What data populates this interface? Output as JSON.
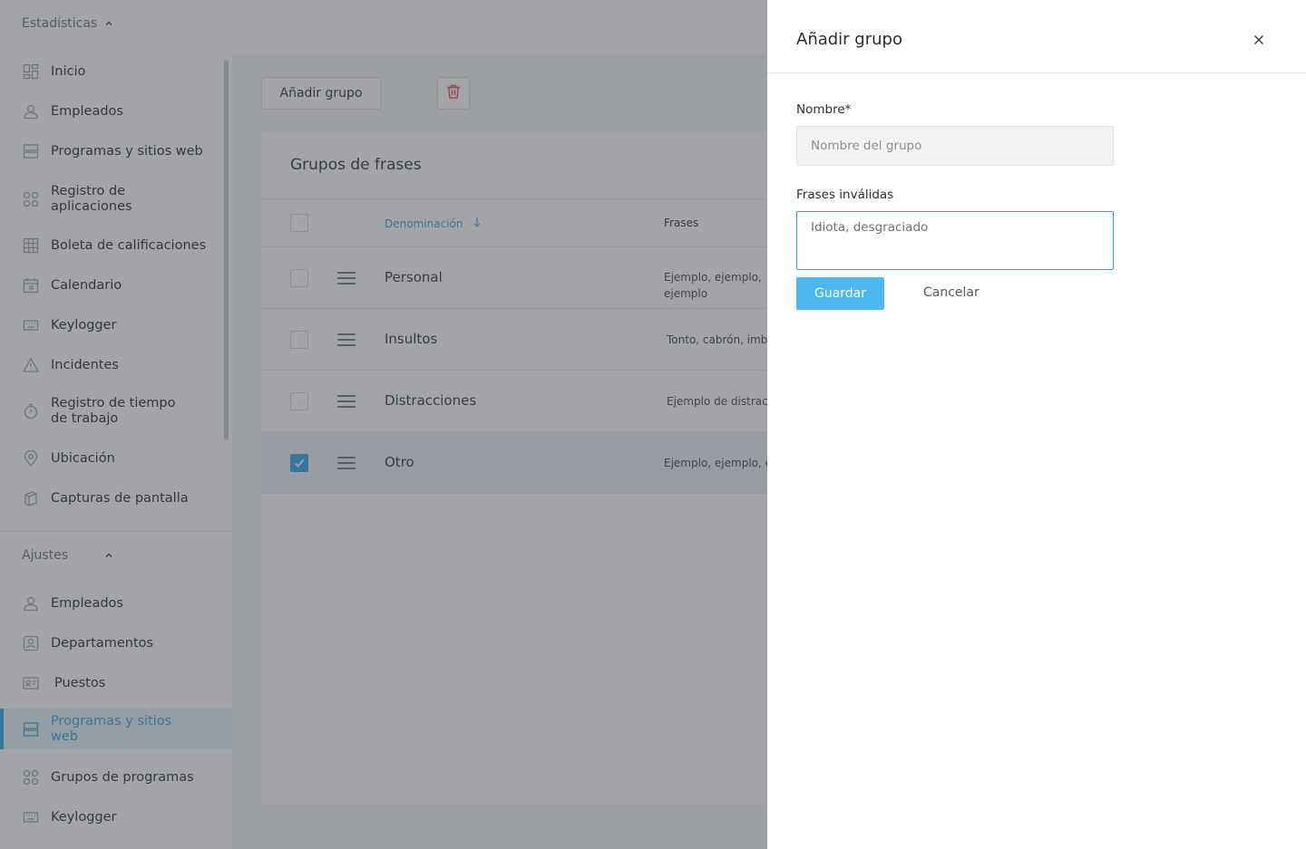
{
  "sidebar": {
    "section_stats": {
      "label": "Estadísticas"
    },
    "stats_items": [
      {
        "label": "Inicio",
        "icon": "dashboard-icon"
      },
      {
        "label": "Empleados",
        "icon": "user-icon"
      },
      {
        "label": "Programas y sitios web",
        "icon": "server-icon"
      },
      {
        "label": "Registro de aplicaciones",
        "icon": "apps-grid-icon"
      },
      {
        "label": "Boleta de calificaciones",
        "icon": "table-grid-icon"
      },
      {
        "label": "Calendario",
        "icon": "calendar-icon"
      },
      {
        "label": "Keylogger",
        "icon": "keyboard-icon"
      },
      {
        "label": "Incidentes",
        "icon": "warning-icon"
      },
      {
        "label": "Registro de tiempo de trabajo",
        "icon": "stopwatch-icon"
      },
      {
        "label": "Ubicación",
        "icon": "location-pin-icon"
      },
      {
        "label": "Capturas de pantalla",
        "icon": "screenshots-icon"
      }
    ],
    "section_settings": {
      "label": "Ajustes"
    },
    "settings_items": [
      {
        "label": "Empleados",
        "icon": "user-icon"
      },
      {
        "label": "Departamentos",
        "icon": "department-icon"
      },
      {
        "label": "Puestos",
        "icon": "id-card-icon"
      },
      {
        "label": "Programas y sitios web",
        "icon": "server-icon",
        "active": true
      },
      {
        "label": "Grupos de programas",
        "icon": "apps-grid-icon"
      },
      {
        "label": "Keylogger",
        "icon": "keyboard-icon"
      }
    ]
  },
  "toolbar": {
    "add_group_label": "Añadir grupo",
    "delete_icon": "trash-icon"
  },
  "table": {
    "title": "Grupos de frases",
    "headers": {
      "name": "Denominación",
      "sort_icon": "arrow-down-icon",
      "phrases": "Frases"
    },
    "rows": [
      {
        "name": "Personal",
        "phrases": "Ejemplo, ejemplo, ejemplo",
        "checked": false
      },
      {
        "name": "Insultos",
        "phrases": "Tonto, cabrón, imbécil",
        "checked": false
      },
      {
        "name": "Distracciones",
        "phrases": "Ejemplo de distracción",
        "checked": false
      },
      {
        "name": "Otro",
        "phrases": "Ejemplo, ejemplo, ejemplo",
        "checked": true
      }
    ]
  },
  "drawer": {
    "title": "Añadir grupo",
    "close_icon": "close-icon",
    "name_label": "Nombre*",
    "name_placeholder": "Nombre del grupo",
    "name_value": "",
    "phrases_label": "Frases inválidas",
    "phrases_value": "Idiota, desgraciado",
    "save_label": "Guardar",
    "cancel_label": "Cancelar"
  },
  "colors": {
    "accent": "#2aa0e0",
    "save_button": "#4cb8ef",
    "delete_icon": "#e5484d"
  }
}
